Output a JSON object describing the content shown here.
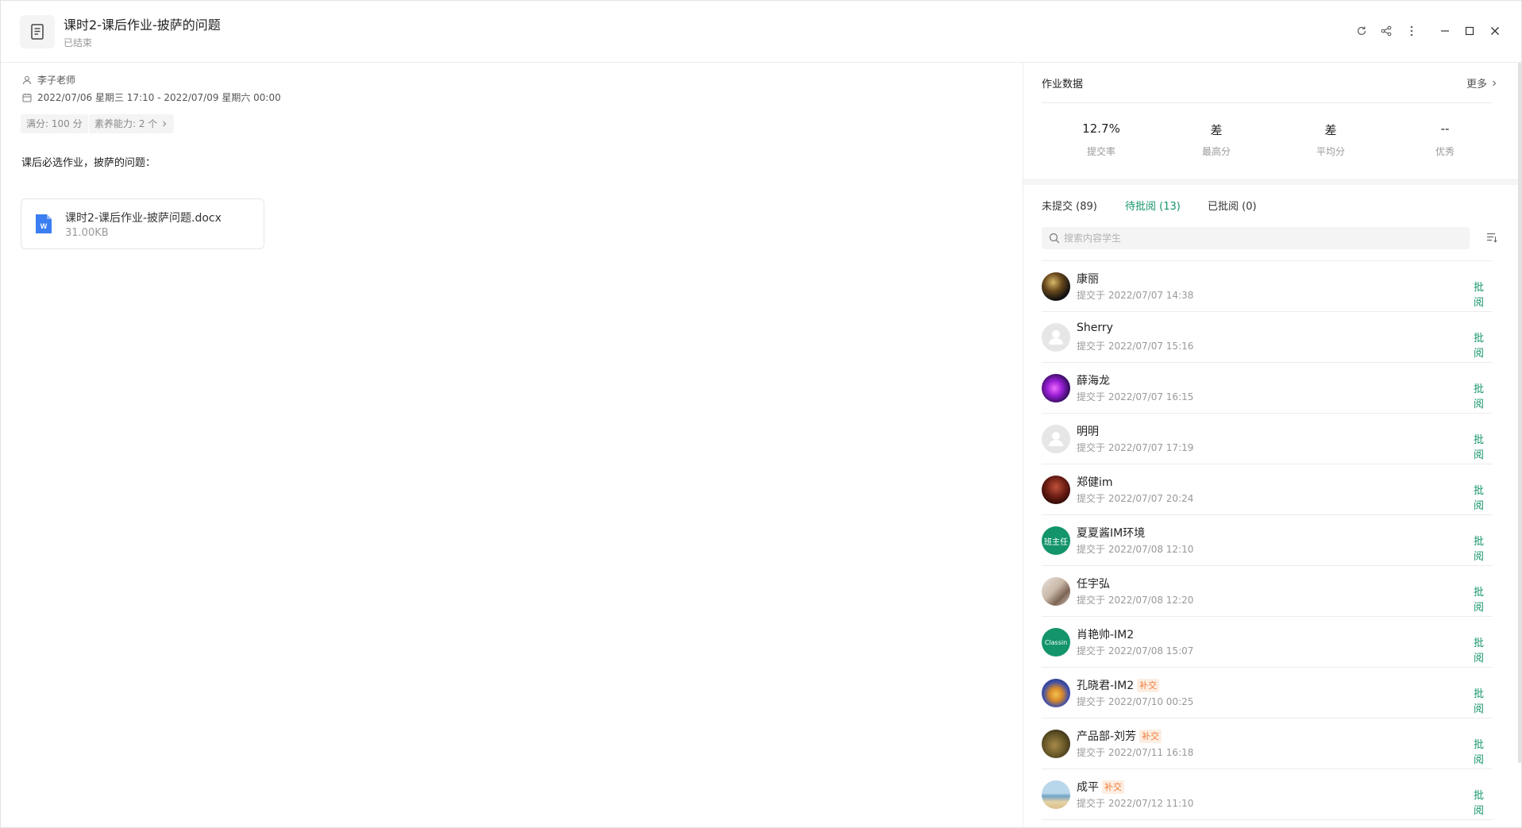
{
  "header": {
    "title": "课时2-课后作业-披萨的问题",
    "status": "已结束"
  },
  "main": {
    "teacher": "李子老师",
    "date_range": "2022/07/06 星期三 17:10 - 2022/07/09 星期六 00:00",
    "tags": [
      "满分: 100 分",
      "素养能力: 2 个"
    ],
    "description": "课后必选作业，披萨的问题：",
    "attachment": {
      "name": "课时2-课后作业-披萨问题.docx",
      "size": "31.00KB",
      "icon": "word-file-icon"
    }
  },
  "panel": {
    "title": "作业数据",
    "more": "更多",
    "stats": [
      {
        "value": "12.7%",
        "label": "提交率"
      },
      {
        "value": "差",
        "label": "最高分"
      },
      {
        "value": "差",
        "label": "平均分"
      },
      {
        "value": "--",
        "label": "优秀"
      }
    ],
    "tabs": [
      "未提交 (89)",
      "待批阅 (13)",
      "已批阅 (0)"
    ],
    "active_tab": 1,
    "search_placeholder": "搜索内容学生",
    "review_label": "批阅",
    "accent_color": "#13946b",
    "late_color": "#f07a3a",
    "students": [
      {
        "name": "康丽",
        "time": "提交于 2022/07/07 14:38",
        "late": ""
      },
      {
        "name": "Sherry",
        "time": "提交于 2022/07/07 15:16",
        "late": ""
      },
      {
        "name": "薛海龙",
        "time": "提交于 2022/07/07 16:15",
        "late": ""
      },
      {
        "name": "明明",
        "time": "提交于 2022/07/07 17:19",
        "late": ""
      },
      {
        "name": "郑健im",
        "time": "提交于 2022/07/07 20:24",
        "late": ""
      },
      {
        "name": "夏夏酱IM环境",
        "time": "提交于 2022/07/08 12:10",
        "late": "",
        "avatar_text": "班主任"
      },
      {
        "name": "任宇弘",
        "time": "提交于 2022/07/08 12:20",
        "late": ""
      },
      {
        "name": "肖艳帅-IM2",
        "time": "提交于 2022/07/08 15:07",
        "late": "",
        "avatar_text": "Classin"
      },
      {
        "name": "孔晓君-IM2",
        "time": "提交于 2022/07/10 00:25",
        "late": "补交"
      },
      {
        "name": "产品部-刘芳",
        "time": "提交于 2022/07/11 16:18",
        "late": "补交"
      },
      {
        "name": "成平",
        "time": "提交于 2022/07/12 11:10",
        "late": "补交"
      }
    ]
  }
}
